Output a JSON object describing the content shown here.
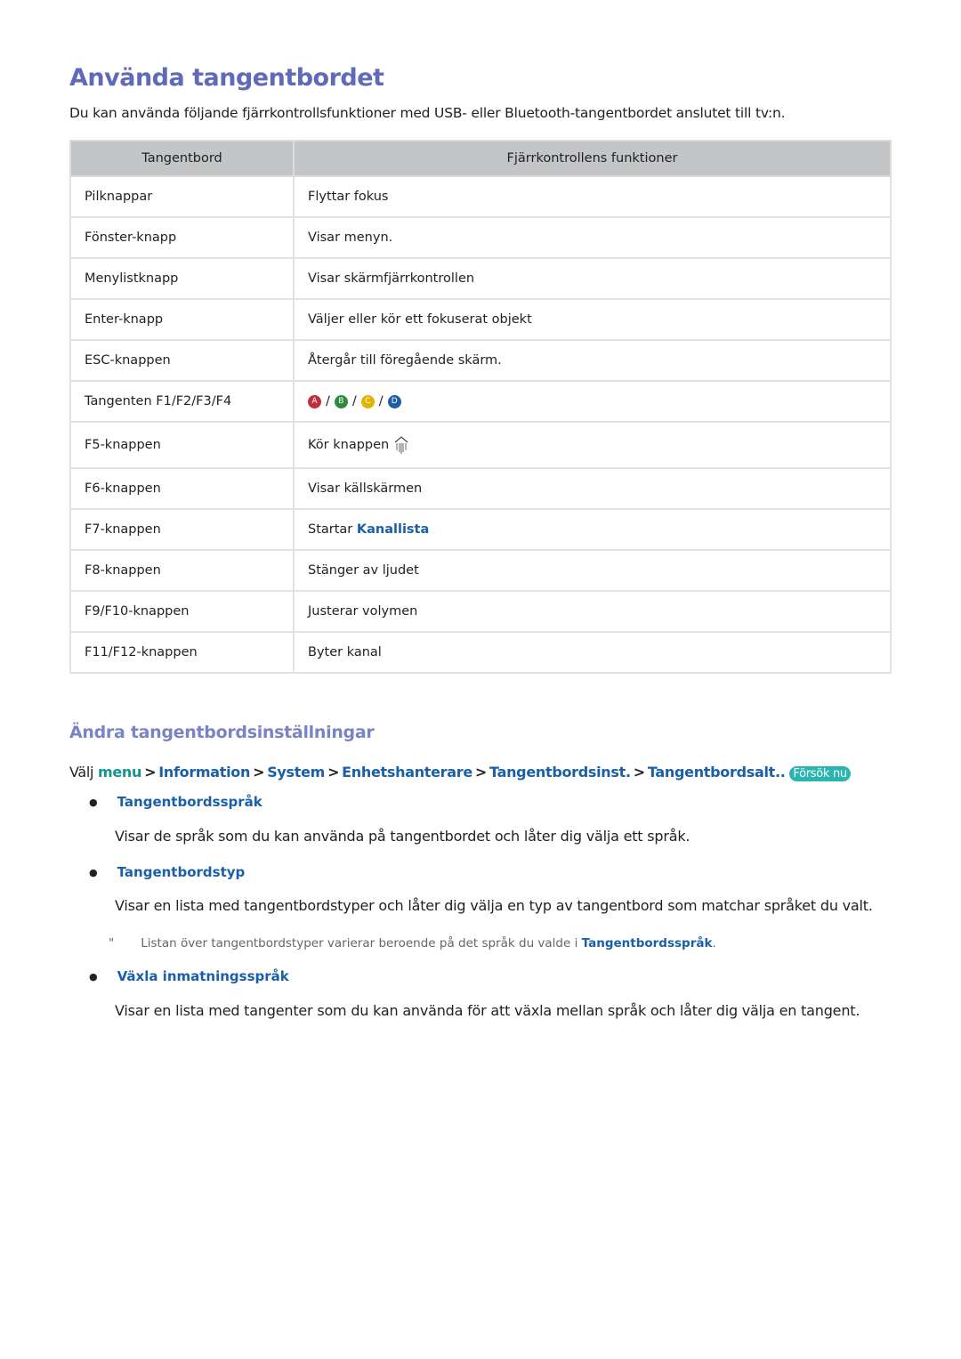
{
  "title": "Använda tangentbordet",
  "intro": "Du kan använda följande fjärrkontrollsfunktioner med USB- eller Bluetooth-tangentbordet anslutet till tv:n.",
  "table": {
    "headers": [
      "Tangentbord",
      "Fjärrkontrollens funktioner"
    ],
    "rows": [
      {
        "key": "Pilknappar",
        "func": "Flyttar fokus"
      },
      {
        "key": "Fönster-knapp",
        "func": "Visar menyn."
      },
      {
        "key": "Menylistknapp",
        "func": "Visar skärmfjärrkontrollen"
      },
      {
        "key": "Enter-knapp",
        "func": "Väljer eller kör ett fokuserat objekt"
      },
      {
        "key": "ESC-knappen",
        "func": "Återgår till föregående skärm."
      },
      {
        "key": "Tangenten F1/F2/F3/F4",
        "color_buttons": [
          {
            "label": "A",
            "color": "#c0303c"
          },
          {
            "label": "B",
            "color": "#2e8b3e"
          },
          {
            "label": "C",
            "color": "#e2b400"
          },
          {
            "label": "D",
            "color": "#1d5fa6"
          }
        ],
        "separator": "/"
      },
      {
        "key": "F5-knappen",
        "func": "Kör knappen",
        "icon": "smart-hub-icon"
      },
      {
        "key": "F6-knappen",
        "func": "Visar källskärmen"
      },
      {
        "key": "F7-knappen",
        "func": "Startar",
        "func_link": "Kanallista"
      },
      {
        "key": "F8-knappen",
        "func": "Stänger av ljudet"
      },
      {
        "key": "F9/F10-knappen",
        "func": "Justerar volymen"
      },
      {
        "key": "F11/F12-knappen",
        "func": "Byter kanal"
      }
    ]
  },
  "section2": {
    "title": "Ändra tangentbordsinställningar",
    "path_prefix": "Välj",
    "path": [
      "menu",
      "Information",
      "System",
      "Enhetshanterare",
      "Tangentbordsinst.",
      "Tangentbordsalt.."
    ],
    "try_now": "Försök nu",
    "items": [
      {
        "label": "Tangentbordsspråk",
        "desc": "Visar de språk som du kan använda på tangentbordet och låter dig välja ett språk."
      },
      {
        "label": "Tangentbordstyp",
        "desc": "Visar en lista med tangentbordstyper och låter dig välja en typ av tangentbord som matchar språket du valt.",
        "note": {
          "mark": "\"",
          "text": "Listan över tangentbordstyper varierar beroende på det språk du valde i ",
          "link": "Tangentbordsspråk",
          "end": "."
        }
      },
      {
        "label": "Växla inmatningsspråk",
        "desc": "Visar en lista med tangenter som du kan använda för att växla mellan språk och låter dig välja en tangent."
      }
    ]
  }
}
